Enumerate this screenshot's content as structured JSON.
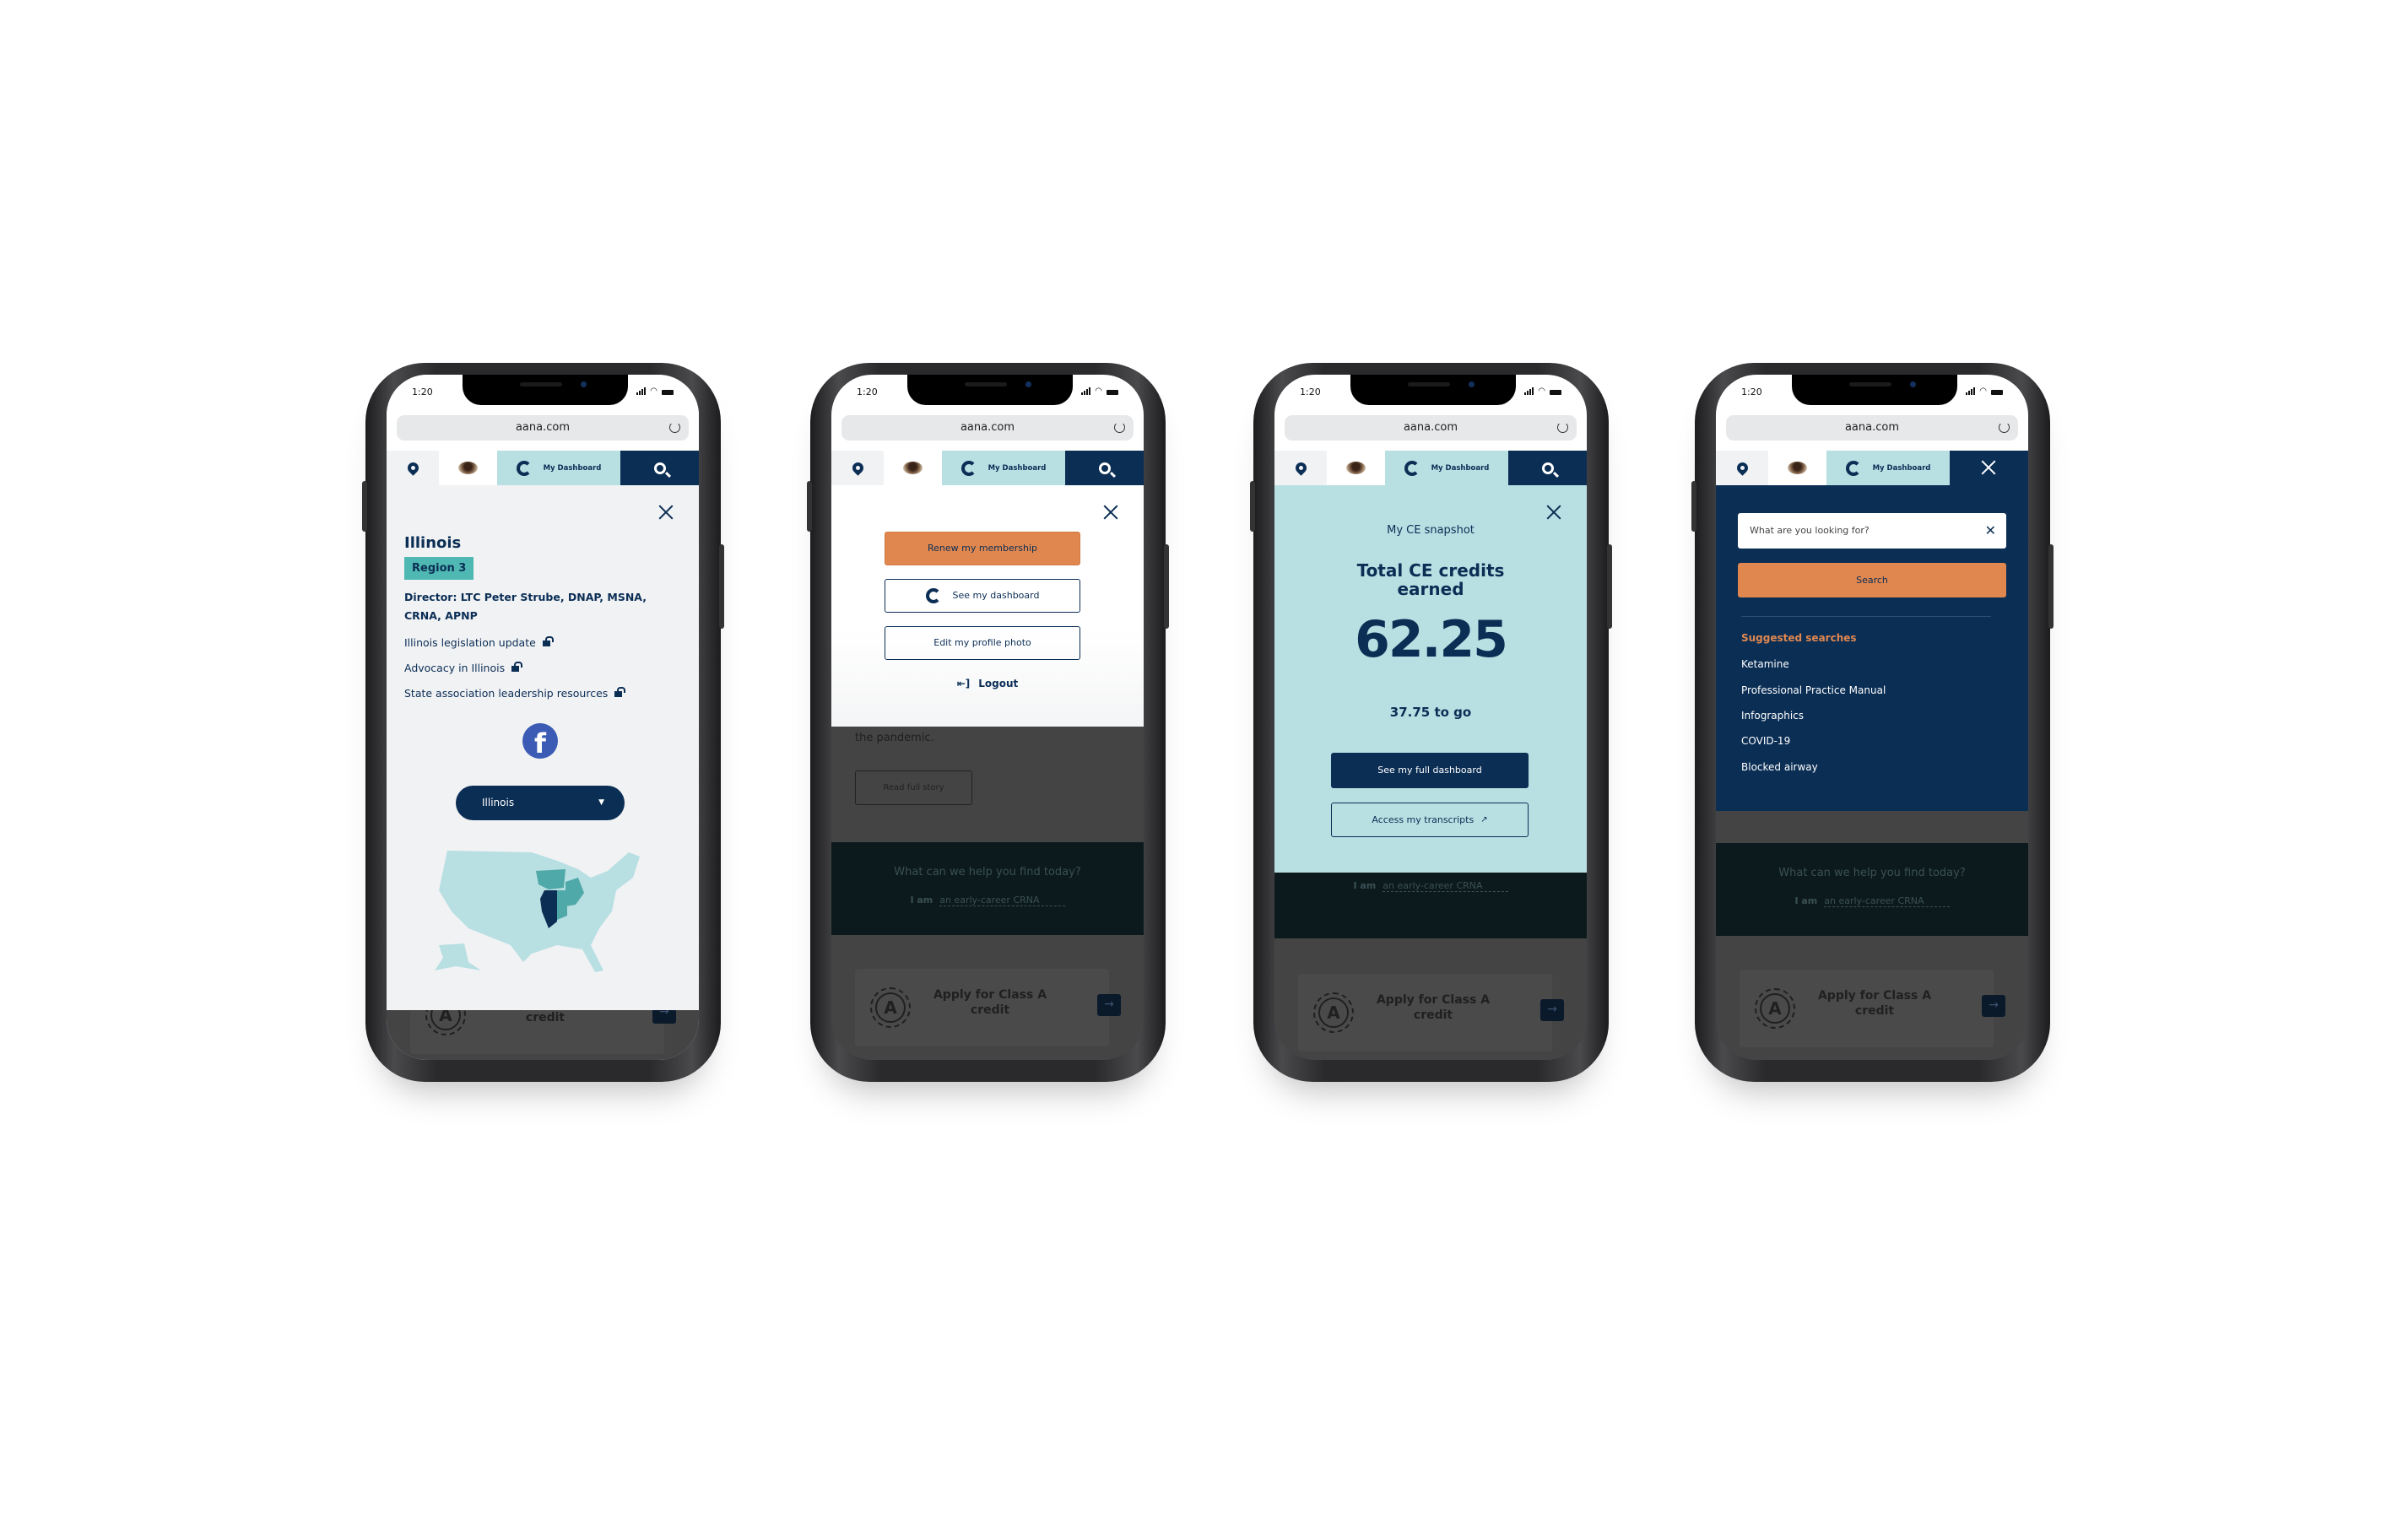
{
  "colors": {
    "navy": "#0b2e55",
    "teal_light": "#b8dfe2",
    "teal_badge": "#4fb8b2",
    "orange": "#e0874f",
    "facebook": "#3b5bb5"
  },
  "common": {
    "time": "1:20",
    "url": "aana.com",
    "nav_dashboard": "My Dashboard",
    "bg_question": "What can we help you find today?",
    "bg_iam": "I am",
    "bg_role": "an early-career CRNA",
    "bg_card": "Apply for Class A credit",
    "bg_seal": "A"
  },
  "state_panel": {
    "title": "Illinois",
    "region": "Region 3",
    "director": "Director: LTC Peter Strube, DNAP, MSNA, CRNA, APNP",
    "links": [
      "Illinois legislation update",
      "Advocacy in Illinois",
      "State association leadership resources"
    ],
    "state_select": "Illinois"
  },
  "profile_menu": {
    "renew": "Renew my membership",
    "dashboard": "See my dashboard",
    "edit_photo": "Edit my profile photo",
    "logout": "Logout",
    "bg_text": "the pandemic.",
    "bg_button": "Read full story"
  },
  "ce_snapshot": {
    "heading": "My CE snapshot",
    "label": "Total CE credits earned",
    "value": "62.25",
    "remaining": "37.75 to go",
    "full_dashboard": "See my full dashboard",
    "transcripts": "Access my transcripts"
  },
  "search_panel": {
    "placeholder": "What are you looking for?",
    "search": "Search",
    "suggested_heading": "Suggested searches",
    "suggestions": [
      "Ketamine",
      "Professional Practice Manual",
      "Infographics",
      "COVID-19",
      "Blocked airway"
    ]
  }
}
